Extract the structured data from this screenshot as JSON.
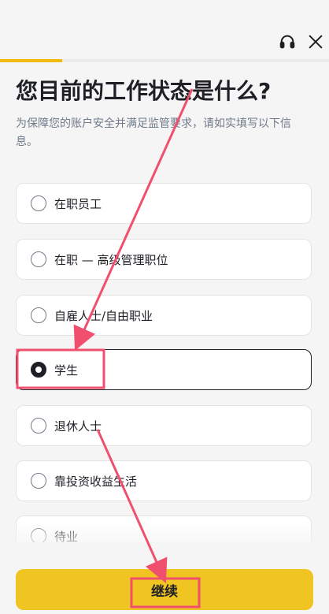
{
  "header": {
    "support_icon": "headset-icon",
    "close_icon": "close-icon",
    "progress": 0.19
  },
  "page": {
    "title": "您目前的工作状态是什么?",
    "subtitle": "为保障您的账户安全并满足监管要求，请如实填写以下信息。"
  },
  "options": [
    {
      "label": "在职员工",
      "selected": false
    },
    {
      "label": "在职 — 高级管理职位",
      "selected": false
    },
    {
      "label": "自雇人士/自由职业",
      "selected": false
    },
    {
      "label": "学生",
      "selected": true
    },
    {
      "label": "退休人士",
      "selected": false
    },
    {
      "label": "靠投资收益生活",
      "selected": false
    },
    {
      "label": "待业",
      "selected": false
    }
  ],
  "footer": {
    "continue_label": "继续"
  },
  "colors": {
    "accent": "#f0b90b",
    "button": "#f0c522",
    "annotation": "#f0506e"
  }
}
